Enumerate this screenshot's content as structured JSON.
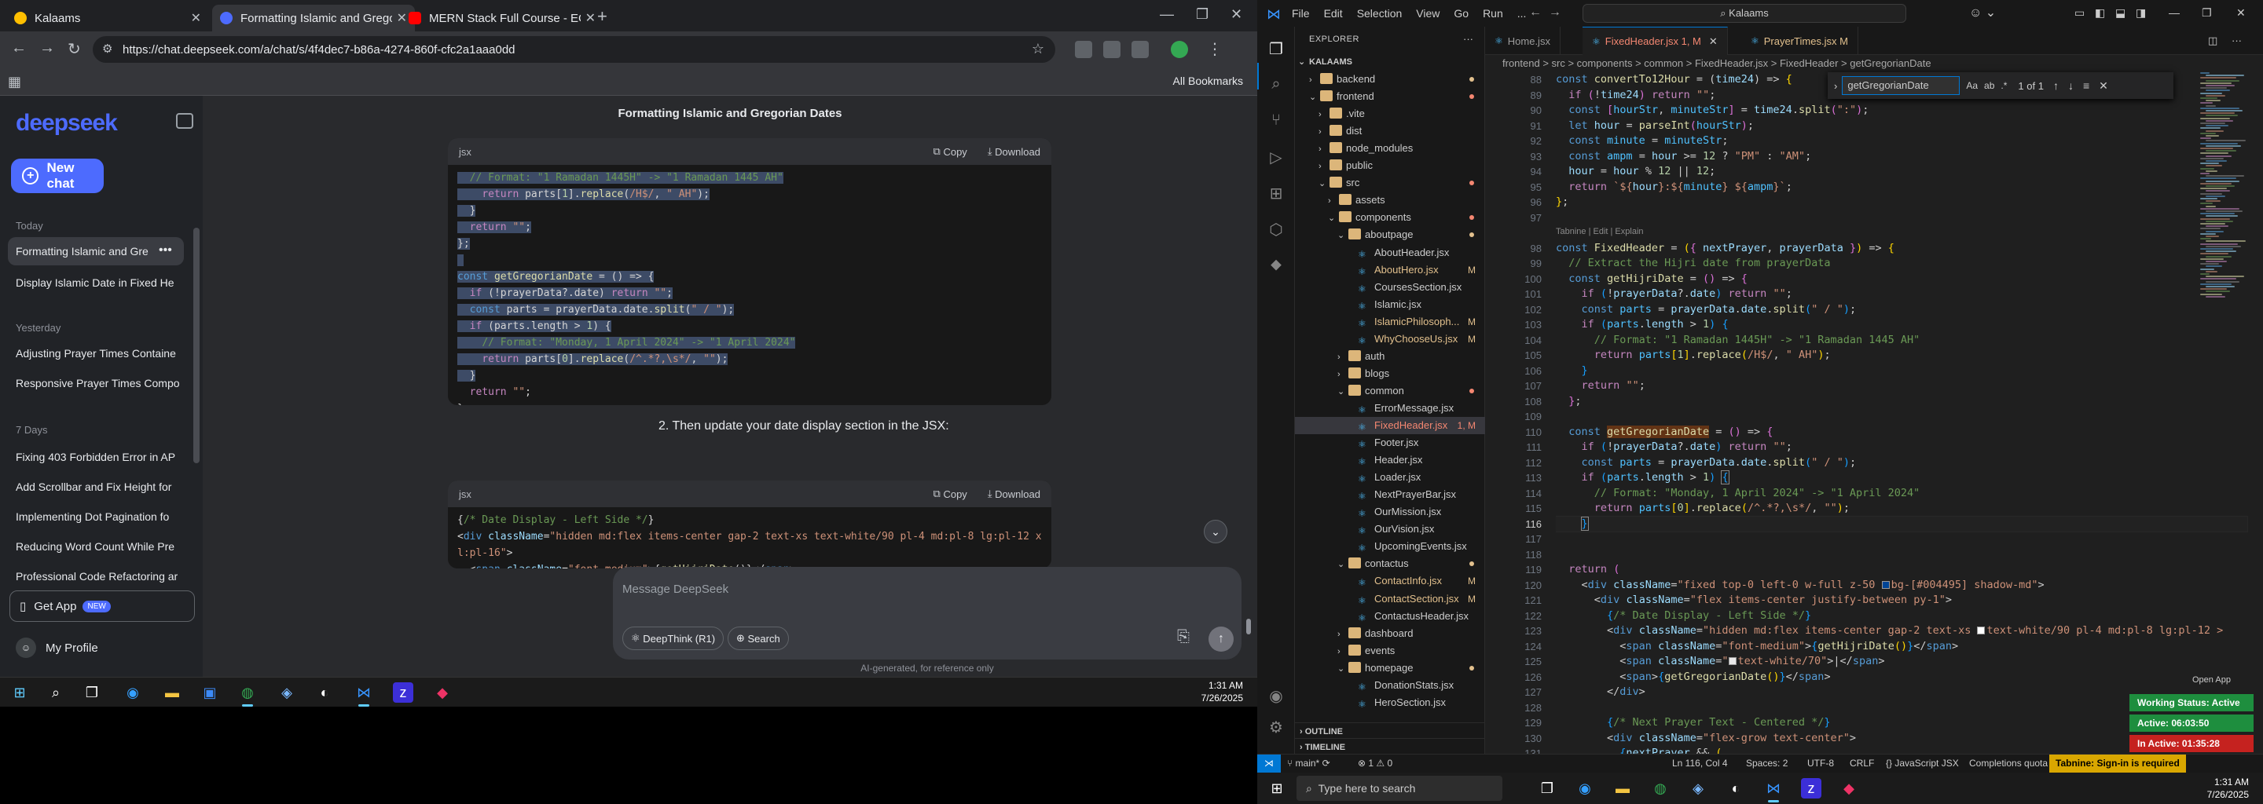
{
  "chrome": {
    "tabs": [
      {
        "title": "Kalaams",
        "color": "#ffbf00"
      },
      {
        "title": "Formatting Islamic and Gregori",
        "color": "#4d6bfe"
      },
      {
        "title": "MERN Stack Full Course - ECom",
        "color": "#ff0000"
      }
    ],
    "url": "https://chat.deepseek.com/a/chat/s/4f4dec7-b86a-4274-860f-cfc2a1aaa0dd",
    "all_bookmarks": "All Bookmarks"
  },
  "deepseek": {
    "logo": "deepseek",
    "new_chat": "New chat",
    "groups": {
      "today": "Today",
      "yesterday": "Yesterday",
      "days7": "7 Days"
    },
    "history_today": [
      "Formatting Islamic and Gre",
      "Display Islamic Date in Fixed He"
    ],
    "history_yesterday": [
      "Adjusting Prayer Times Containe",
      "Responsive Prayer Times Compo"
    ],
    "history_7days": [
      "Fixing 403 Forbidden Error in AP",
      "Add Scrollbar and Fix Height for",
      "Implementing Dot Pagination fo",
      "Reducing Word Count While Pre",
      "Professional Code Refactoring ar"
    ],
    "get_app": "Get App",
    "get_app_badge": "NEW",
    "profile": "My Profile",
    "chat_title": "Formatting Islamic and Gregorian Dates",
    "code_lang": "jsx",
    "copy": "Copy",
    "download": "Download",
    "step2": "2. Then update your date display section in the JSX:",
    "composer_placeholder": "Message DeepSeek",
    "deepthink": "DeepThink (R1)",
    "search": "Search",
    "disclaimer": "AI-generated, for reference only"
  },
  "taskbar_left": {
    "time": "1:31 AM",
    "date": "7/26/2025"
  },
  "vscode": {
    "menu": [
      "File",
      "Edit",
      "Selection",
      "View",
      "Go",
      "Run",
      "..."
    ],
    "command_center": "Kalaams",
    "explorer_title": "EXPLORER",
    "root": "KALAAMS",
    "tabs": [
      {
        "label": "Home.jsx",
        "state": ""
      },
      {
        "label": "FixedHeader.jsx 1, M",
        "state": "on"
      },
      {
        "label": "PrayerTimes.jsx M",
        "state": ""
      }
    ],
    "breadcrumb": "frontend > src > components > common > FixedHeader.jsx > FixedHeader > getGregorianDate",
    "find": {
      "query": "getGregorianDate",
      "count": "1 of 1"
    },
    "tabnine_hint": "Tabnine | Edit | Explain",
    "outline": "OUTLINE",
    "timeline": "TIMELINE",
    "status": {
      "branch": "main*",
      "problems": "⊗ 1 ⚠ 0",
      "position": "Ln 116, Col 4",
      "spaces": "Spaces: 2",
      "encoding": "UTF-8",
      "eol": "CRLF",
      "lang": "{} JavaScript JSX",
      "completions": "Completions quota reached",
      "tabnine": "Tabnine: Sign-in is required"
    }
  },
  "working_status": {
    "open_app": "Open App",
    "items": [
      {
        "label": "Working Status: Active",
        "color": "#1e8e3e"
      },
      {
        "label": "Active: 06:03:50",
        "color": "#1e8e3e"
      },
      {
        "label": "In Active: 01:35:28",
        "color": "#c5221f"
      }
    ]
  },
  "taskbar_right": {
    "search_placeholder": "Type here to search",
    "time": "1:31 AM",
    "date": "7/26/2025"
  }
}
